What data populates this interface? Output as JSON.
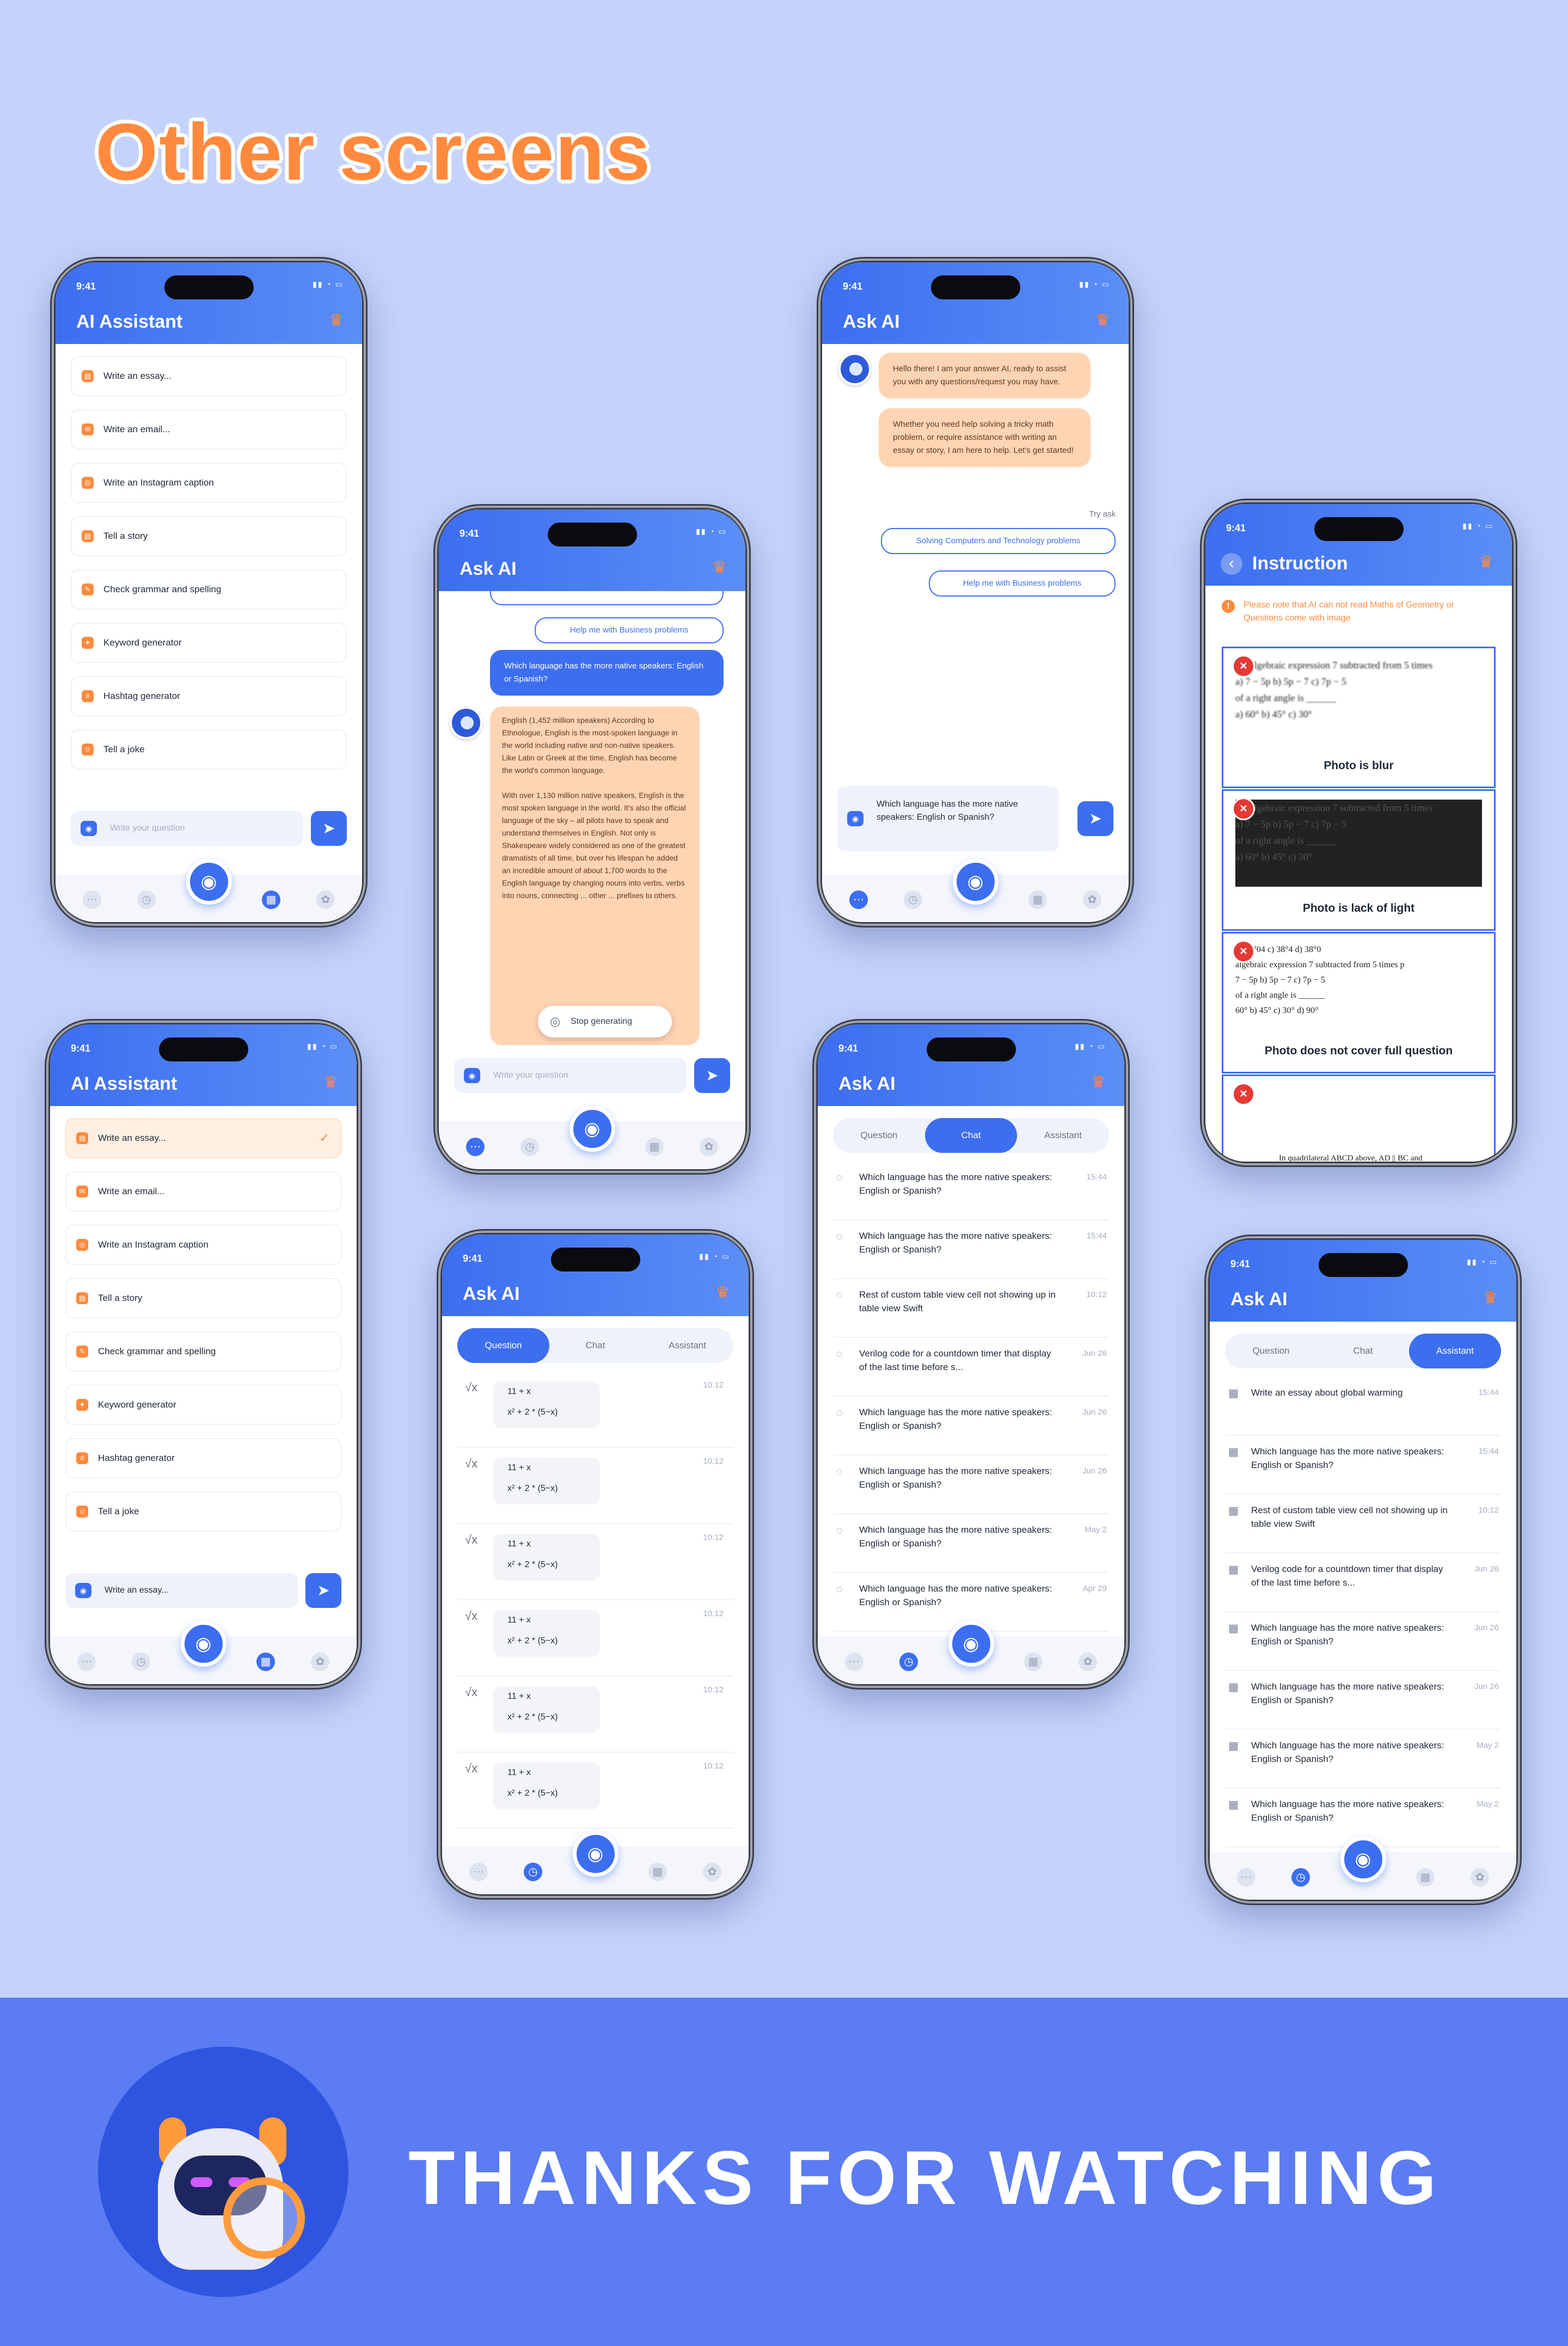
{
  "page": {
    "title": "Other screens",
    "footer": "THANKS FOR WATCHING"
  },
  "status": {
    "time": "9:41",
    "icons": "▮▮ ◔ ▭"
  },
  "icons": {
    "crown": "crown-icon",
    "camera": "camera-icon",
    "send": "send-icon"
  },
  "colors": {
    "primary": "#3c6ef0",
    "accent": "#ff8a3d",
    "background": "#c5d3fa",
    "band": "#5b7cf2"
  },
  "assistant": {
    "title": "AI Assistant",
    "placeholder": "Write your question",
    "filled_input": "Write an essay...",
    "items": [
      "Write an essay...",
      "Write an email...",
      "Write an Instagram caption",
      "Tell a story",
      "Check grammar and spelling",
      "Keyword generator",
      "Hashtag generator",
      "Tell a joke"
    ],
    "item_icons": [
      "▤",
      "✉",
      "◎",
      "▤",
      "✎",
      "✦",
      "#",
      "☺"
    ]
  },
  "askai": {
    "title": "Ask AI",
    "greeting": "Hello there! I am your answer AI, ready to assist you with any questions/request you may have.",
    "intro": "Whether you need help solving a tricky math problem, or require assistance with writing an essay or story, I am here to help. Let's get started!",
    "try_ask": "Try ask",
    "suggestions": [
      "Solving Computers and Technology problems",
      "Help me with Business problems"
    ],
    "question": "Which language has the more native speakers: English or Spanish?",
    "answer": "English (1,452 million speakers) According to Ethnologue, English is the most-spoken language in the world including native and non-native speakers. Like Latin or Greek at the time, English has become the world's common language.\n\nWith over 1,130 million native speakers, English is the most spoken language in the world. It's also the official language of the sky – all pilots have to speak and understand themselves in English. Not only is Shakespeare widely considered as one of the greatest dramatists of all time, but over his lifespan he added an incredible amount of about 1,700 words to the English language by changing nouns into verbs, verbs into nouns, connecting ... other ... prefixes to others.",
    "stop": "Stop generating",
    "placeholder": "Write your question"
  },
  "tabs": [
    "Question",
    "Chat",
    "Assistant"
  ],
  "history_chat": [
    {
      "t": "Which language has the more native speakers: English or Spanish?",
      "ts": "15:44"
    },
    {
      "t": "Which language has the more native speakers: English or Spanish?",
      "ts": "15:44"
    },
    {
      "t": "Rest of custom table view cell not showing up in table view Swift",
      "ts": "10:12"
    },
    {
      "t": "Verilog code for a countdown timer that display of the last time before s...",
      "ts": "Jun 26"
    },
    {
      "t": "Which language has the more native speakers: English or Spanish?",
      "ts": "Jun 26"
    },
    {
      "t": "Which language has the more native speakers: English or Spanish?",
      "ts": "Jun 26"
    },
    {
      "t": "Which language has the more native speakers: English or Spanish?",
      "ts": "May 2"
    },
    {
      "t": "Which language has the more native speakers: English or Spanish?",
      "ts": "Apr 29"
    }
  ],
  "history_assistant": [
    {
      "t": "Write an essay about global warming",
      "ts": "15:44"
    },
    {
      "t": "Which language has the more native speakers: English or Spanish?",
      "ts": "15:44"
    },
    {
      "t": "Rest of custom table view cell not showing up in table view Swift",
      "ts": "10:12"
    },
    {
      "t": "Verilog code for a countdown timer that display of the last time before s...",
      "ts": "Jun 26"
    },
    {
      "t": "Which language has the more native speakers: English or Spanish?",
      "ts": "Jun 26"
    },
    {
      "t": "Which language has the more native speakers: English or Spanish?",
      "ts": "Jun 26"
    },
    {
      "t": "Which language has the more native speakers: English or Spanish?",
      "ts": "May 2"
    },
    {
      "t": "Which language has the more native speakers: English or Spanish?",
      "ts": "May 2"
    }
  ],
  "questions": {
    "formula_top": "11 + x",
    "formula_bottom": "x² + 2 * (5−x)",
    "time": "10:12",
    "symbol": "√x"
  },
  "instruction": {
    "title": "Instruction",
    "note": "Please note that AI can not read Maths of Geometry or Questions come with image",
    "cards": [
      {
        "caption": "Photo is blur",
        "text": "the algebraic expression  7 subtracted from 5 times\na) 7 − 5p    b) 5p − 7    c) 7p − 5\nof a right angle is ______\na) 60°   b) 45°   c) 30°"
      },
      {
        "caption": "Photo is lack of light",
        "text": "the algebraic expression  7 subtracted from 5 times\na) 7 − 5p    b) 5p − 7    c) 7p − 5\nof a right angle is ______\na) 60°   b) 45°   c) 30°"
      },
      {
        "caption": "Photo does not cover full question",
        "text": "a) 38°04   c) 38°4    d) 38°0\nalgebraic expression  7 subtracted from 5 times p\n7 − 5p    b) 5p − 7    c) 7p − 5\nof a right angle is ______\n60°   b) 45°   c) 30°   d) 90°"
      },
      {
        "caption": "",
        "text": "In quadrilateral ABCD above, AD || BC and"
      }
    ]
  }
}
